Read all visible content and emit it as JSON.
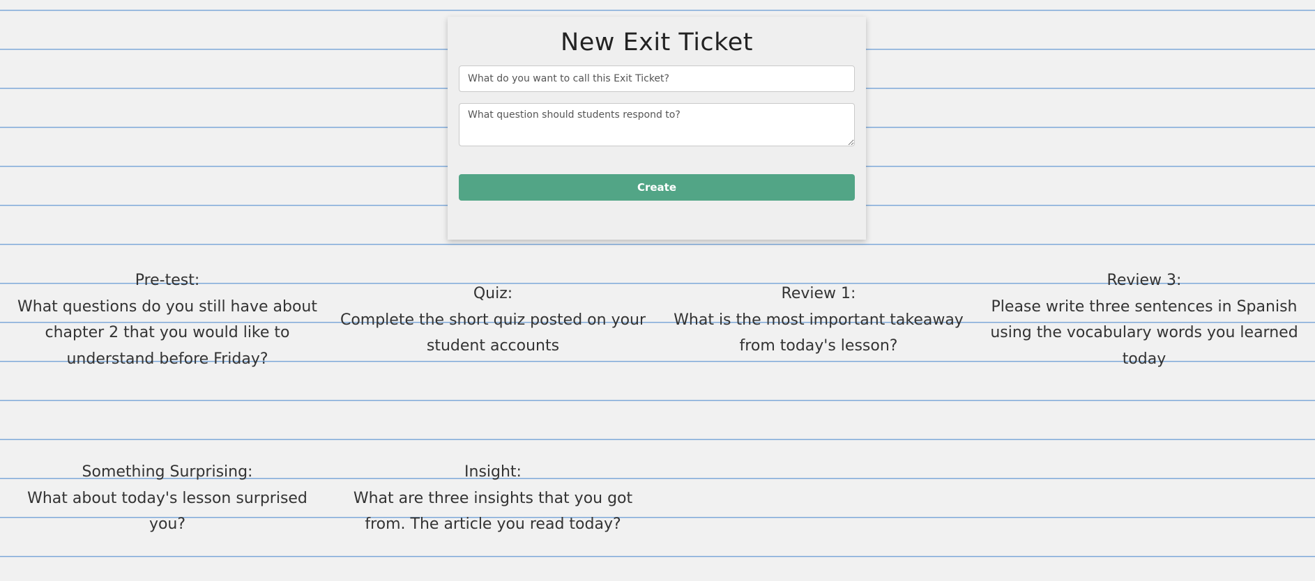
{
  "form": {
    "title": "New Exit Ticket",
    "name_placeholder": "What do you want to call this Exit Ticket?",
    "question_placeholder": "What question should students respond to?",
    "create_label": "Create"
  },
  "tickets": [
    {
      "title": "Pre-test:",
      "question": "What questions do you still have about chapter 2 that you would like to understand before Friday?"
    },
    {
      "title": "Quiz:",
      "question": "Complete the short quiz posted on your student accounts"
    },
    {
      "title": "Review 1:",
      "question": "What is the most important takeaway from today's lesson?"
    },
    {
      "title": "Review 3:",
      "question": "Please write three sentences in Spanish using the vocabulary words you learned today"
    },
    {
      "title": "Something Surprising:",
      "question": "What about today's lesson surprised you?"
    },
    {
      "title": "Insight:",
      "question": "What are three insights that you got from. The article you read today?"
    }
  ],
  "colors": {
    "background": "#f1f1f1",
    "ruled_line": "#7ea9d9",
    "create_button": "#52a586"
  }
}
